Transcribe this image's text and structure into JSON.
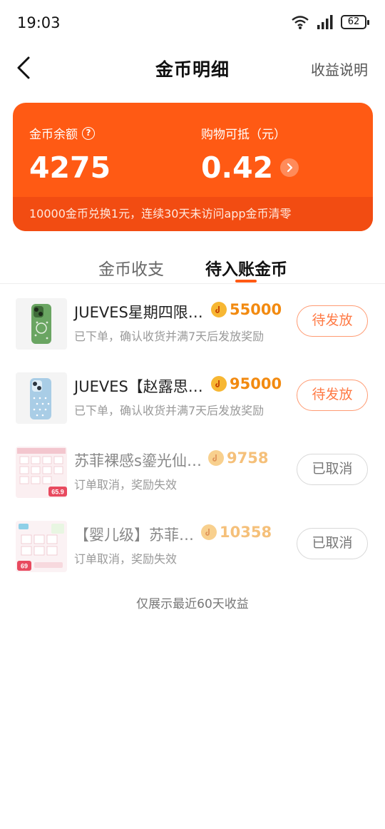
{
  "status_bar": {
    "time": "19:03",
    "battery": "62"
  },
  "nav": {
    "title": "金币明细",
    "action": "收益说明"
  },
  "coin_card": {
    "balance_label": "金币余额",
    "balance_value": "4275",
    "shopping_label": "购物可抵（元）",
    "shopping_value": "0.42",
    "footer": "10000金币兑换1元，连续30天未访问app金币清零"
  },
  "tabs": [
    {
      "label": "金币收支"
    },
    {
      "label": "待入账金币"
    }
  ],
  "records": [
    {
      "title": "JUEVES星期四限…",
      "amount": "55000",
      "desc": "已下单，确认收货并满7天后发放奖励",
      "status": "待发放"
    },
    {
      "title": "JUEVES【赵露思…",
      "amount": "95000",
      "desc": "已下单，确认收货并满7天后发放奖励",
      "status": "待发放"
    },
    {
      "title": "苏菲裸感s鎏光仙…",
      "amount": "9758",
      "desc": "订单取消，奖励失效",
      "status": "已取消"
    },
    {
      "title": "【婴儿级】苏菲…",
      "amount": "10358",
      "desc": "订单取消，奖励失效",
      "status": "已取消"
    }
  ],
  "thumbs": {
    "r3_price": "65.9",
    "r4_price": "69"
  },
  "footnote": "仅展示最近60天收益",
  "colors": {
    "accent": "#ff5a14",
    "coin": "#f28a10"
  }
}
